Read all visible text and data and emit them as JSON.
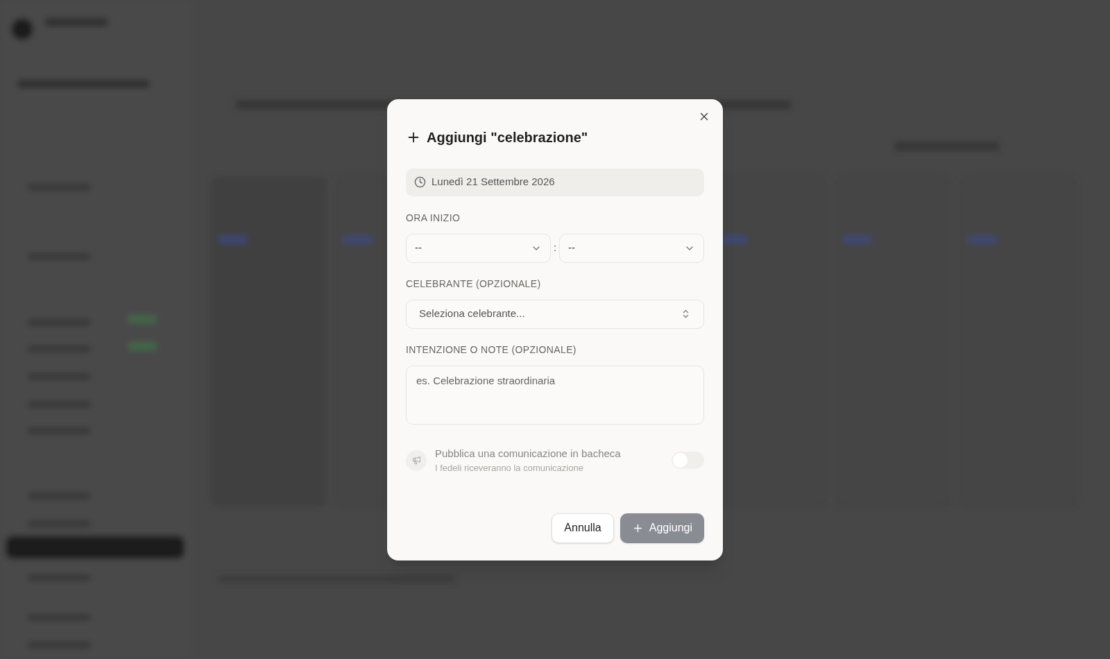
{
  "dialog": {
    "title": "Aggiungi \"celebrazione\"",
    "date": "Lunedì 21 Settembre 2026",
    "start_time": {
      "label": "ORA INIZIO",
      "hour": "--",
      "separator": ":",
      "minute": "--"
    },
    "celebrant": {
      "label": "CELEBRANTE (OPZIONALE)",
      "value": "Seleziona celebrante..."
    },
    "notes": {
      "label": "INTENZIONE O NOTE (OPZIONALE)",
      "placeholder": "es. Celebrazione straordinaria"
    },
    "publish": {
      "title": "Pubblica una comunicazione in bacheca",
      "subtitle": "I fedeli riceveranno la comunicazione",
      "on": false
    },
    "buttons": [
      {
        "label": "Annulla",
        "kind": "cancel",
        "disabled": false
      },
      {
        "label": "Aggiungi",
        "kind": "submit",
        "disabled": true
      }
    ]
  }
}
